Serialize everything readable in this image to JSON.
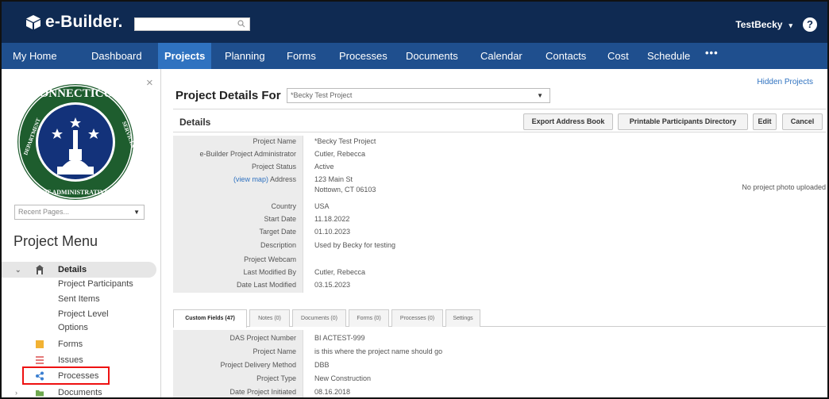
{
  "brand": {
    "name": "e-Builder."
  },
  "search": {
    "placeholder": ""
  },
  "user": {
    "name": "TestBecky",
    "help": "?"
  },
  "nav": [
    {
      "label": "My Home"
    },
    {
      "label": "Dashboard"
    },
    {
      "label": "Projects"
    },
    {
      "label": "Planning"
    },
    {
      "label": "Forms"
    },
    {
      "label": "Processes"
    },
    {
      "label": "Documents"
    },
    {
      "label": "Calendar"
    },
    {
      "label": "Contacts"
    },
    {
      "label": "Cost"
    },
    {
      "label": "Schedule"
    },
    {
      "label": "•••"
    }
  ],
  "sidebar": {
    "close": "×",
    "recent_pages": "Recent Pages...",
    "menu_title": "Project Menu",
    "details": "Details",
    "sub_items": [
      "Project Participants",
      "Sent Items",
      "Project Level",
      "Options"
    ],
    "items": [
      {
        "label": "Forms"
      },
      {
        "label": "Issues"
      },
      {
        "label": "Processes"
      },
      {
        "label": "Documents"
      }
    ]
  },
  "main": {
    "hidden_projects": "Hidden Projects",
    "title": "Project Details For",
    "project_select": "*Becky Test Project",
    "details_heading": "Details",
    "buttons": {
      "export": "Export Address Book",
      "directory": "Printable Participants Directory",
      "edit": "Edit",
      "cancel": "Cancel"
    },
    "view_map": "(view map)",
    "fields": [
      {
        "label": "Project Name",
        "value": "*Becky Test Project"
      },
      {
        "label": "e-Builder Project Administrator",
        "value": "Cutler, Rebecca"
      },
      {
        "label": "Project Status",
        "value": "Active"
      },
      {
        "label": "Address",
        "value": "123 Main St",
        "value2": "Nottown, CT 06103"
      },
      {
        "label": "Country",
        "value": "USA"
      },
      {
        "label": "Start Date",
        "value": "11.18.2022"
      },
      {
        "label": "Target Date",
        "value": "01.10.2023"
      },
      {
        "label": "Description",
        "value": "Used by Becky for testing"
      },
      {
        "label": "Project Webcam",
        "value": ""
      },
      {
        "label": "Last Modified By",
        "value": "Cutler, Rebecca"
      },
      {
        "label": "Date Last Modified",
        "value": "03.15.2023"
      }
    ],
    "no_photo": "No project photo uploaded",
    "tabs": [
      {
        "label": "Custom Fields (47)"
      },
      {
        "label": "Notes (0)"
      },
      {
        "label": "Documents (0)"
      },
      {
        "label": "Forms (0)"
      },
      {
        "label": "Processes (0)"
      },
      {
        "label": "Settings"
      }
    ],
    "custom_fields": [
      {
        "label": "DAS Project Number",
        "value": "BI ACTEST-999"
      },
      {
        "label": "Project Name",
        "value": "is this where the project name should go"
      },
      {
        "label": "Project Delivery Method",
        "value": "DBB"
      },
      {
        "label": "Project Type",
        "value": "New Construction"
      },
      {
        "label": "Date Project Initiated",
        "value": "08.16.2018"
      }
    ]
  },
  "colors": {
    "topbar": "#0f2a52",
    "navbar": "#1f4f8e",
    "nav_active": "#2f72c0",
    "highlight": "#e11111"
  }
}
